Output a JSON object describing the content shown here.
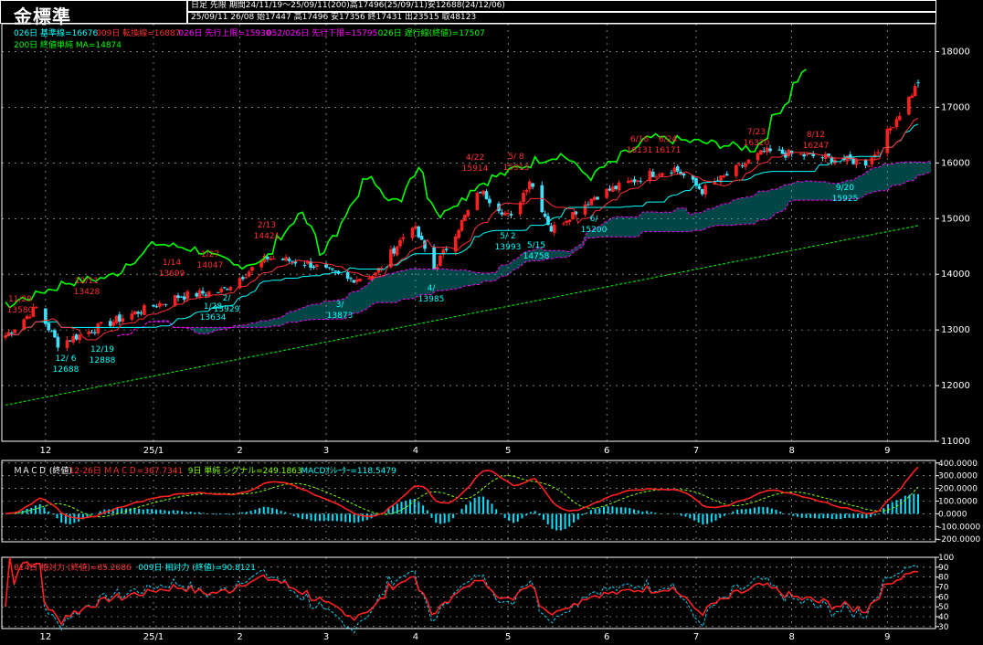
{
  "title": "金標準",
  "header": {
    "line1": "日足  先限  期間24/11/19～25/09/11(200)高17496(25/09/11)安12688(24/12/06)",
    "line2": "25/09/11 26/08 始17447 高17496 安17356 終17431 出23515 取48123"
  },
  "legend_main": [
    {
      "text": "026日 基準線=16676",
      "color": "#00ffff"
    },
    {
      "text": "009日 転換線=16887",
      "color": "#ff3030"
    },
    {
      "text": "026日 先行上限=15930",
      "color": "#ff00ff"
    },
    {
      "text": "052/026日 先行下限=15795",
      "color": "#ff00ff"
    },
    {
      "text": "026日 遅行線(終値)=17507",
      "color": "#00ff00"
    }
  ],
  "legend_main2": [
    {
      "text": "200日 終値単純 MA=14874",
      "color": "#00ff00"
    }
  ],
  "legend_macd": [
    {
      "text": "ＭＡＣＤ (終値)",
      "color": "#ffffff"
    },
    {
      "text": "12-26日 ＭＡＣＤ=367.7341",
      "color": "#ff3030"
    },
    {
      "text": "9日 単純 シグナル=249.1863",
      "color": "#80ff00"
    },
    {
      "text": "MACDｵｼﾚｰﾀｰ=118.5479",
      "color": "#00ffff"
    }
  ],
  "legend_rsi": [
    {
      "text": "014日 相対力 (終値)=85.2086",
      "color": "#ff3030"
    },
    {
      "text": "009日 相対力 (終値)=90.8121",
      "color": "#00ffff"
    }
  ],
  "colors": {
    "up": "#ff2020",
    "down": "#40e0ff",
    "grid": "#ffffff",
    "frame": "#ffffff"
  },
  "chart_data": [
    {
      "type": "candlestick",
      "title": "金標準",
      "x_tick_labels": [
        "12",
        "25/1",
        "2",
        "3",
        "4",
        "5",
        "6",
        "7",
        "8",
        "9"
      ],
      "y_tick_labels": [
        "11000",
        "12000",
        "13000",
        "14000",
        "15000",
        "16000",
        "17000",
        "18000"
      ],
      "ylim": [
        11000,
        18500
      ],
      "date_range": [
        "2024-11-19",
        "2025-09-11"
      ],
      "period_high": 17496,
      "period_low": 12688,
      "last": {
        "open": 17447,
        "high": 17496,
        "low": 17356,
        "close": 17431
      },
      "key_closes": [
        {
          "date": "2024-11-19",
          "close": 12900
        },
        {
          "date": "2024-11-29",
          "close": 13400
        },
        {
          "date": "2024-12-06",
          "close": 12750
        },
        {
          "date": "2024-12-26",
          "close": 13200
        },
        {
          "date": "2025-01-14",
          "close": 13600
        },
        {
          "date": "2025-01-28",
          "close": 13700
        },
        {
          "date": "2025-02-12",
          "close": 14300
        },
        {
          "date": "2025-02-25",
          "close": 14200
        },
        {
          "date": "2025-03-10",
          "close": 13900
        },
        {
          "date": "2025-03-19",
          "close": 14000
        },
        {
          "date": "2025-03-31",
          "close": 14900
        },
        {
          "date": "2025-04-07",
          "close": 14100
        },
        {
          "date": "2025-04-22",
          "close": 15500
        },
        {
          "date": "2025-05-02",
          "close": 15000
        },
        {
          "date": "2025-05-08",
          "close": 15700
        },
        {
          "date": "2025-05-15",
          "close": 14800
        },
        {
          "date": "2025-05-29",
          "close": 15400
        },
        {
          "date": "2025-06-16",
          "close": 15800
        },
        {
          "date": "2025-06-24",
          "close": 15900
        },
        {
          "date": "2025-07-03",
          "close": 15500
        },
        {
          "date": "2025-07-23",
          "close": 16200
        },
        {
          "date": "2025-08-12",
          "close": 16100
        },
        {
          "date": "2025-08-26",
          "close": 16000
        },
        {
          "date": "2025-09-11",
          "close": 17431
        }
      ],
      "annotations": [
        {
          "label": "11/29",
          "value": "13580",
          "color": "#ff3030"
        },
        {
          "label": "12/ 6",
          "value": "12688",
          "color": "#00ffff"
        },
        {
          "label": "12/11",
          "value": "13428",
          "color": "#ff3030"
        },
        {
          "label": "12/19",
          "value": "12888",
          "color": "#00ffff"
        },
        {
          "label": "1/14",
          "value": "13699",
          "color": "#ff3030"
        },
        {
          "label": "1/27",
          "value": "14047",
          "color": "#ff3030"
        },
        {
          "label": "1/28",
          "value": "13634",
          "color": "#00ffff"
        },
        {
          "label": "2/",
          "value": "13929",
          "color": "#00ffff"
        },
        {
          "label": "2/13",
          "value": "14421",
          "color": "#ff3030"
        },
        {
          "label": "3/",
          "value": "13873",
          "color": "#00ffff"
        },
        {
          "label": "4/",
          "value": "13985",
          "color": "#00ffff"
        },
        {
          "label": "4/22",
          "value": "15914",
          "color": "#ff3030"
        },
        {
          "label": "5/ 2",
          "value": "13993",
          "color": "#00ffff"
        },
        {
          "label": "5/ 8",
          "value": "15913",
          "color": "#ff3030"
        },
        {
          "label": "5/15",
          "value": "14758",
          "color": "#00ffff"
        },
        {
          "label": "6/",
          "value": "15200",
          "color": "#00ffff"
        },
        {
          "label": "6/16",
          "value": "16131",
          "color": "#ff3030"
        },
        {
          "label": "6/24",
          "value": "16171",
          "color": "#ff3030"
        },
        {
          "label": "7/23",
          "value": "16320",
          "color": "#ff3030"
        },
        {
          "label": "8/12",
          "value": "16247",
          "color": "#ff3030"
        },
        {
          "label": "9/20",
          "value": "15925",
          "color": "#00ffff"
        }
      ],
      "series": [
        {
          "name": "026日 基準線",
          "color": "#00ffff",
          "last": 16676
        },
        {
          "name": "009日 転換線",
          "color": "#ff3030",
          "last": 16887
        },
        {
          "name": "026日 先行上限",
          "color": "#ff00ff",
          "last": 15930
        },
        {
          "name": "052/026日 先行下限",
          "color": "#ff00ff",
          "last": 15795
        },
        {
          "name": "026日 遅行線(終値)",
          "color": "#00ff00",
          "last": 17507
        },
        {
          "name": "200日 終値単純 MA",
          "color": "#00ff00",
          "last": 14874
        }
      ],
      "grid": true
    },
    {
      "type": "line",
      "title": "ＭＡＣＤ (終値)",
      "y_tick_labels": [
        "400.0000",
        "300.0000",
        "200.0000",
        "100.0000",
        "0.0000",
        "-100.0000",
        "-200.0000"
      ],
      "ylim": [
        -220,
        420
      ],
      "series": [
        {
          "name": "12-26日 ＭＡＣＤ",
          "color": "#ff3030",
          "last": 367.7341
        },
        {
          "name": "9日 単純 シグナル",
          "color": "#80ff00",
          "last": 249.1863
        },
        {
          "name": "MACDｵｼﾚｰﾀｰ",
          "color": "#00ffff",
          "last": 118.5479
        }
      ],
      "grid": true
    },
    {
      "type": "line",
      "title": "相対力",
      "y_tick_labels": [
        "100",
        "90",
        "80",
        "70",
        "60",
        "50",
        "40",
        "30"
      ],
      "ylim": [
        28,
        100
      ],
      "series": [
        {
          "name": "014日 相対力 (終値)",
          "color": "#ff3030",
          "last": 85.2086
        },
        {
          "name": "009日 相対力 (終値)",
          "color": "#00ffff",
          "last": 90.8121
        }
      ],
      "grid": true
    }
  ]
}
